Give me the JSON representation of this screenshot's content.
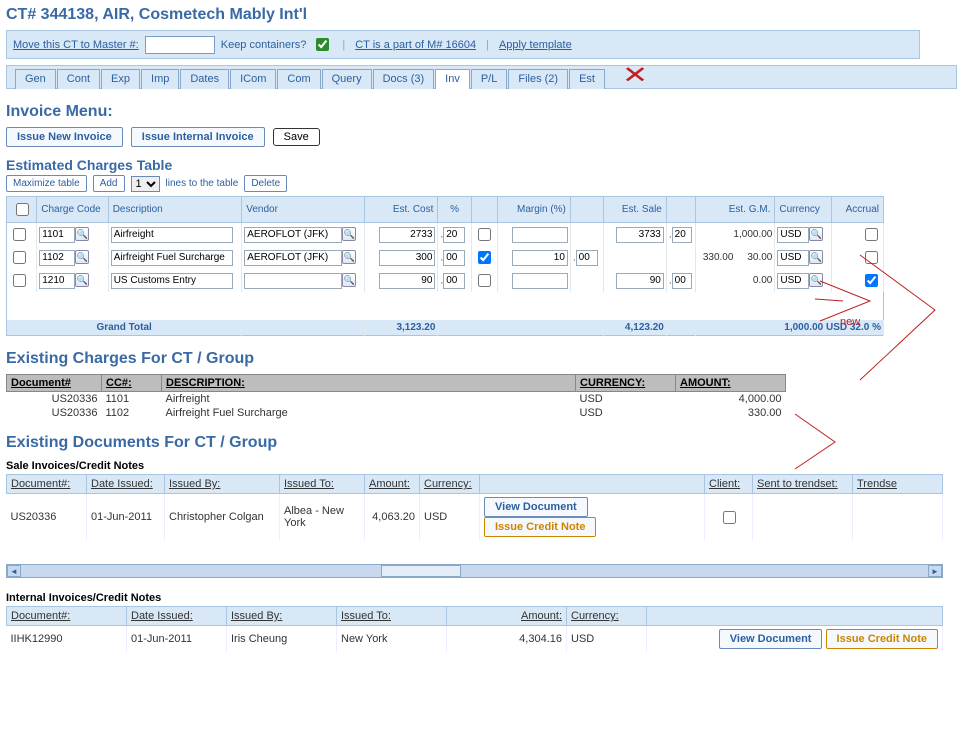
{
  "header": {
    "title": "CT# 344138, AIR, Cosmetech Mably Int'l",
    "move_label": "Move this CT to Master #:",
    "move_value": "",
    "keep_containers_label": "Keep containers?",
    "keep_containers_checked": true,
    "part_of_label": "CT is a part of M# 16604",
    "apply_template_label": "Apply template"
  },
  "tabs": [
    {
      "label": "Gen"
    },
    {
      "label": "Cont"
    },
    {
      "label": "Exp"
    },
    {
      "label": "Imp"
    },
    {
      "label": "Dates"
    },
    {
      "label": "ICom"
    },
    {
      "label": "Com"
    },
    {
      "label": "Query"
    },
    {
      "label": "Docs (3)"
    },
    {
      "label": "Inv",
      "active": true
    },
    {
      "label": "P/L"
    },
    {
      "label": "Files (2)"
    },
    {
      "label": "Est"
    }
  ],
  "invoice_menu": {
    "title": "Invoice Menu:",
    "issue_new": "Issue New Invoice",
    "issue_internal": "Issue Internal Invoice",
    "save": "Save"
  },
  "est_table": {
    "title": "Estimated Charges Table",
    "maximize": "Maximize table",
    "add": "Add",
    "lines_value": "1",
    "lines_label": "lines to the table",
    "delete": "Delete",
    "headers": {
      "charge_code": "Charge Code",
      "description": "Description",
      "vendor": "Vendor",
      "est_cost": "Est. Cost",
      "pct": "%",
      "margin": "Margin (%)",
      "est_sale": "Est. Sale",
      "est_gm": "Est. G.M.",
      "currency": "Currency",
      "accrual": "Accrual"
    },
    "rows": [
      {
        "code": "1101",
        "desc": "Airfreight",
        "vendor": "AEROFLOT (JFK)",
        "cost": "2733",
        "costPct": "20",
        "margin_chk": false,
        "margin": "",
        "marginPct": "",
        "sale": "3733",
        "salePct": "20",
        "gm": "1,000.00",
        "cur": "USD",
        "accrual": false
      },
      {
        "code": "1102",
        "desc": "Airfreight Fuel Surcharge",
        "vendor": "AEROFLOT (JFK)",
        "cost": "300",
        "costPct": "00",
        "margin_chk": true,
        "margin": "10",
        "marginPct": "00",
        "sale": "",
        "salePct": "",
        "gm": "330.00     30.00",
        "cur": "USD",
        "accrual": false
      },
      {
        "code": "1210",
        "desc": "US Customs Entry",
        "vendor": "",
        "cost": "90",
        "costPct": "00",
        "margin_chk": false,
        "margin": "",
        "marginPct": "",
        "sale": "90",
        "salePct": "00",
        "gm": "0.00",
        "cur": "USD",
        "accrual": true
      }
    ],
    "grand_total_label": "Grand Total",
    "grand_total_cost": "3,123.20",
    "grand_total_sale": "4,123.20",
    "grand_total_gm_cur": "1,000.00 USD 32.0 %"
  },
  "existing_charges": {
    "title": "Existing Charges For CT / Group",
    "headers": {
      "doc": "Document#",
      "cc": "CC#:",
      "desc": "DESCRIPTION:",
      "cur": "CURRENCY:",
      "amt": "AMOUNT:"
    },
    "rows": [
      {
        "doc": "US20336",
        "cc": "1101",
        "desc": "Airfreight",
        "cur": "USD",
        "amt": "4,000.00"
      },
      {
        "doc": "US20336",
        "cc": "1102",
        "desc": "Airfreight Fuel Surcharge",
        "cur": "USD",
        "amt": "330.00"
      }
    ]
  },
  "existing_docs": {
    "title": "Existing Documents For CT / Group",
    "sale_label": "Sale Invoices/Credit Notes",
    "internal_label": "Internal Invoices/Credit Notes",
    "sale_headers": {
      "doc": "Document#:",
      "date": "Date Issued:",
      "by": "Issued By:",
      "to": "Issued To:",
      "amt": "Amount:",
      "cur": "Currency:",
      "client": "Client:",
      "sent": "Sent to trendset:",
      "trendse": "Trendse"
    },
    "sale_rows": [
      {
        "doc": "US20336",
        "date": "01-Jun-2011",
        "by": "Christopher Colgan",
        "to": "Albea - New York",
        "amt": "4,063.20",
        "cur": "USD",
        "client_chk": false
      }
    ],
    "internal_headers": {
      "doc": "Document#:",
      "date": "Date Issued:",
      "by": "Issued By:",
      "to": "Issued To:",
      "amt": "Amount:",
      "cur": "Currency:"
    },
    "internal_rows": [
      {
        "doc": "IIHK12990",
        "date": "01-Jun-2011",
        "by": "Iris Cheung",
        "to": "New York",
        "amt": "4,304.16",
        "cur": "USD"
      }
    ],
    "view_doc": "View Document",
    "credit_note": "Issue Credit Note"
  },
  "annotations": {
    "new_label": "new"
  }
}
